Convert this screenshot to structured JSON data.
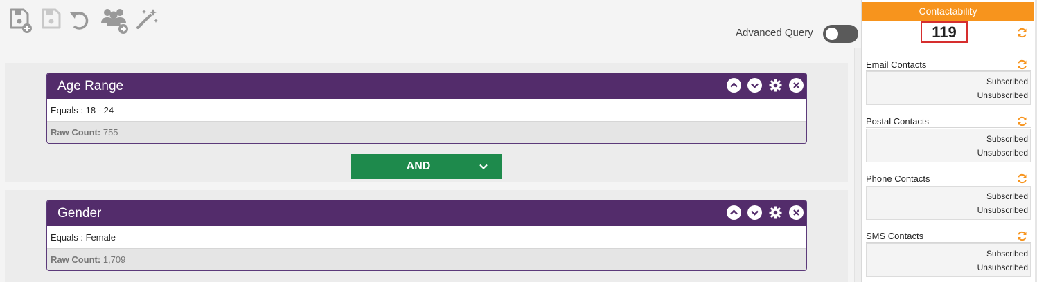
{
  "toolbar": {
    "icons": [
      "save-as-icon",
      "save-icon",
      "undo-icon",
      "share-users-icon",
      "magic-wand-icon"
    ],
    "advanced_query_label": "Advanced Query",
    "advanced_query_on": false
  },
  "segments": [
    {
      "title": "Age Range",
      "condition": "Equals : 18 - 24",
      "raw_label": "Raw Count:",
      "raw_value": "755"
    },
    {
      "title": "Gender",
      "condition": "Equals : Female",
      "raw_label": "Raw Count:",
      "raw_value": "1,709"
    }
  ],
  "operator": {
    "label": "AND"
  },
  "contactability": {
    "title": "Contactability",
    "count": "119",
    "groups": [
      {
        "label": "Email Contacts",
        "subscribed": "Subscribed",
        "unsubscribed": "Unsubscribed"
      },
      {
        "label": "Postal Contacts",
        "subscribed": "Subscribed",
        "unsubscribed": "Unsubscribed"
      },
      {
        "label": "Phone Contacts",
        "subscribed": "Subscribed",
        "unsubscribed": "Unsubscribed"
      },
      {
        "label": "SMS Contacts",
        "subscribed": "Subscribed",
        "unsubscribed": "Unsubscribed"
      }
    ]
  },
  "colors": {
    "card_header": "#532c6b",
    "operator_button": "#1e8a4c",
    "panel_header": "#f7941d",
    "refresh_icon": "#f7941d",
    "count_highlight": "#d62e2e"
  }
}
